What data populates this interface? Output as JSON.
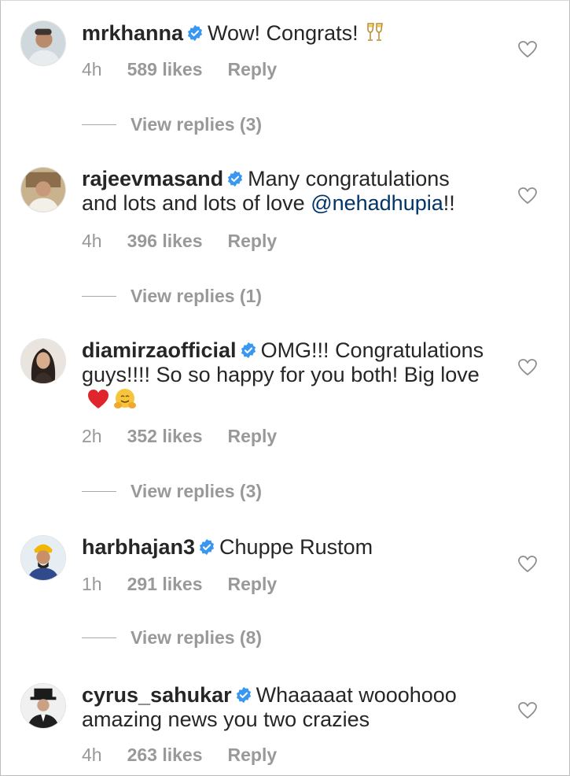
{
  "comments": [
    {
      "username": "mrkhanna",
      "text": "Wow! Congrats!",
      "emoji": "champagne-glasses",
      "time": "4h",
      "likes": "589 likes",
      "reply": "Reply",
      "view_replies": "View replies (3)"
    },
    {
      "username": "rajeevmasand",
      "text_before": "Many congratulations and lots and lots of love ",
      "mention": "@nehadhupia",
      "text_after": "!!",
      "time": "4h",
      "likes": "396 likes",
      "reply": "Reply",
      "view_replies": "View replies (1)"
    },
    {
      "username": "diamirzaofficial",
      "text": "OMG!!! Congratulations guys!!!! So so happy for you both! Big love",
      "emojis": [
        "red-heart",
        "hugging-face"
      ],
      "time": "2h",
      "likes": "352 likes",
      "reply": "Reply",
      "view_replies": "View replies (3)"
    },
    {
      "username": "harbhajan3",
      "text": "Chuppe Rustom",
      "time": "1h",
      "likes": "291 likes",
      "reply": "Reply",
      "view_replies": "View replies (8)"
    },
    {
      "username": "cyrus_sahukar",
      "text": "Whaaaaat wooohooo amazing news you two crazies",
      "time": "4h",
      "likes": "263 likes",
      "reply": "Reply"
    }
  ],
  "colors": {
    "text": "#262626",
    "muted": "#999999",
    "verified": "#3897f0",
    "mention": "#003569",
    "heart_stroke": "#8e8e8e"
  },
  "icons": [
    "verified-badge-icon",
    "heart-icon"
  ]
}
